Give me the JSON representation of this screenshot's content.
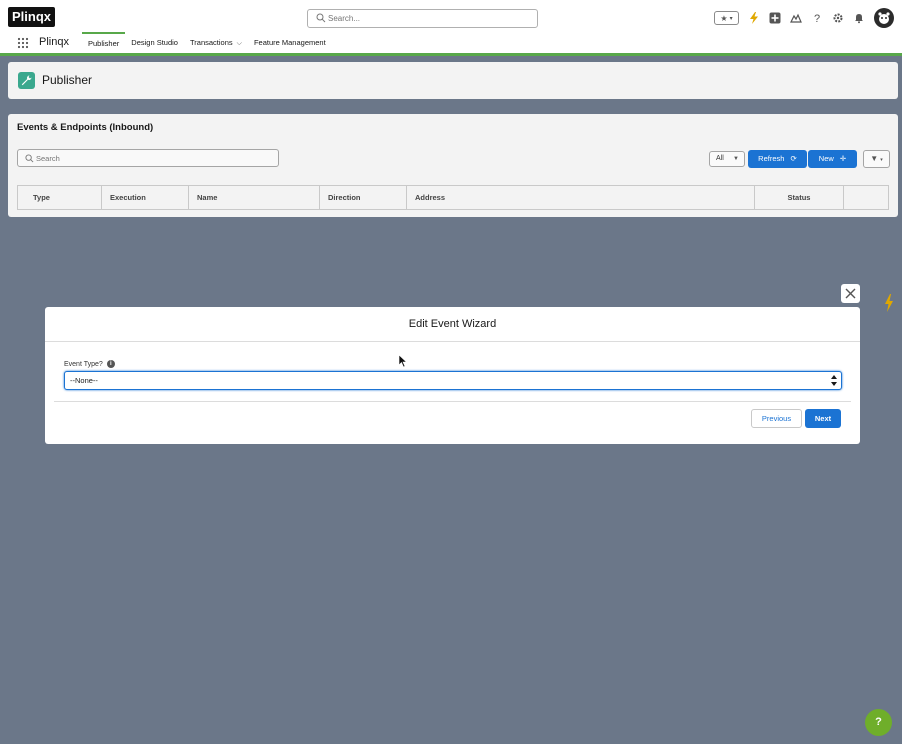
{
  "header": {
    "logo": "Plinqx",
    "search_placeholder": "Search...",
    "app_name": "Plinqx",
    "tabs": [
      {
        "label": "Publisher",
        "active": true
      },
      {
        "label": "Design Studio"
      },
      {
        "label": "Transactions",
        "dropdown": true
      },
      {
        "label": "Feature Management"
      }
    ],
    "icons": [
      "favorites-icon",
      "bolt-icon",
      "add-icon",
      "trailhead-icon",
      "help-icon",
      "setup-icon",
      "bell-icon",
      "avatar-icon"
    ],
    "accent_color": "#58a84a"
  },
  "page": {
    "title": "Publisher",
    "icon": "wrench-icon",
    "icon_color": "#3aa88e"
  },
  "list": {
    "title": "Events & Endpoints (Inbound)",
    "search_placeholder": "Search",
    "filter_value": "All",
    "refresh_label": "Refresh",
    "new_label": "New",
    "columns": [
      "Type",
      "Execution",
      "Name",
      "Direction",
      "Address",
      "Status"
    ]
  },
  "modal": {
    "title": "Edit Event Wizard",
    "field_label": "Event Type?",
    "select_value": "--None--",
    "previous_label": "Previous",
    "next_label": "Next"
  },
  "colors": {
    "brand_blue": "#1b73d3",
    "overlay": "#6b7789"
  },
  "help_button": "?"
}
